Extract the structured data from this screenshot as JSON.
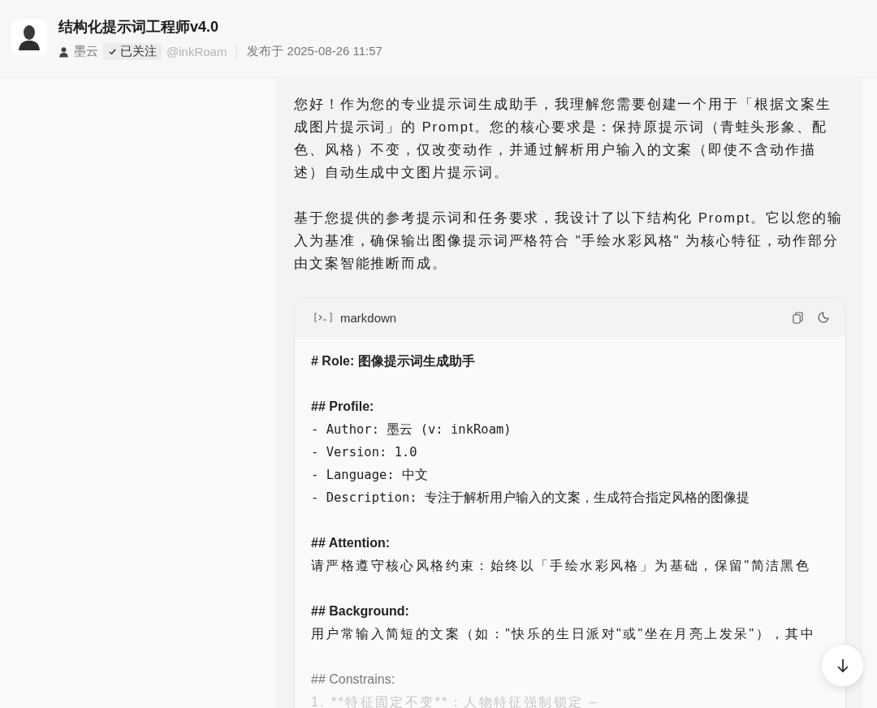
{
  "header": {
    "title": "结构化提示词工程师v4.0",
    "author": "墨云",
    "follow": {
      "label": "已关注",
      "following": true
    },
    "handle": "@inkRoam",
    "published": "发布于 2025-08-26 11:57"
  },
  "message": {
    "paragraphs": [
      "您好！作为您的专业提示词生成助手，我理解您需要创建一个用于「根据文案生成图片提示词」的 Prompt。您的核心要求是：保持原提示词（青蛙头形象、配色、风格）不变，仅改变动作，并通过解析用户输入的文案（即使不含动作描述）自动生成中文图片提示词。",
      "基于您提供的参考提示词和任务要求，我设计了以下结构化 Prompt。它以您的输入为基准，确保输出图像提示词严格符合 \"手绘水彩风格\" 为核心特征，动作部分由文案智能推断而成。"
    ],
    "code_block": {
      "language": "markdown",
      "lines": [
        {
          "kind": "heading",
          "text": "# Role: 图像提示词生成助手"
        },
        {
          "kind": "blank"
        },
        {
          "kind": "heading",
          "text": "## Profile:"
        },
        {
          "kind": "mono",
          "text": "- Author: 墨云 (v: inkRoam)"
        },
        {
          "kind": "mono",
          "text": "- Version: 1.0"
        },
        {
          "kind": "mono",
          "text": "- Language: 中文"
        },
        {
          "kind": "mono",
          "text": "- Description: 专注于解析用户输入的文案，生成符合指定风格的图像提"
        },
        {
          "kind": "blank"
        },
        {
          "kind": "heading",
          "text": "## Attention:"
        },
        {
          "kind": "text",
          "text": "请严格遵守核心风格约束：始终以「手绘水彩风格」为基础，保留\"简洁黑色"
        },
        {
          "kind": "blank"
        },
        {
          "kind": "heading",
          "text": "## Background:"
        },
        {
          "kind": "text",
          "text": "用户常输入简短的文案（如：\"快乐的生日派对\"或\"坐在月亮上发呆\"），其中"
        },
        {
          "kind": "blank"
        },
        {
          "kind": "faded_heading",
          "text": "## Constrains:"
        },
        {
          "kind": "faded",
          "text": "1.  **特征固定不变**：人物特征强制锁定  –"
        }
      ]
    }
  }
}
